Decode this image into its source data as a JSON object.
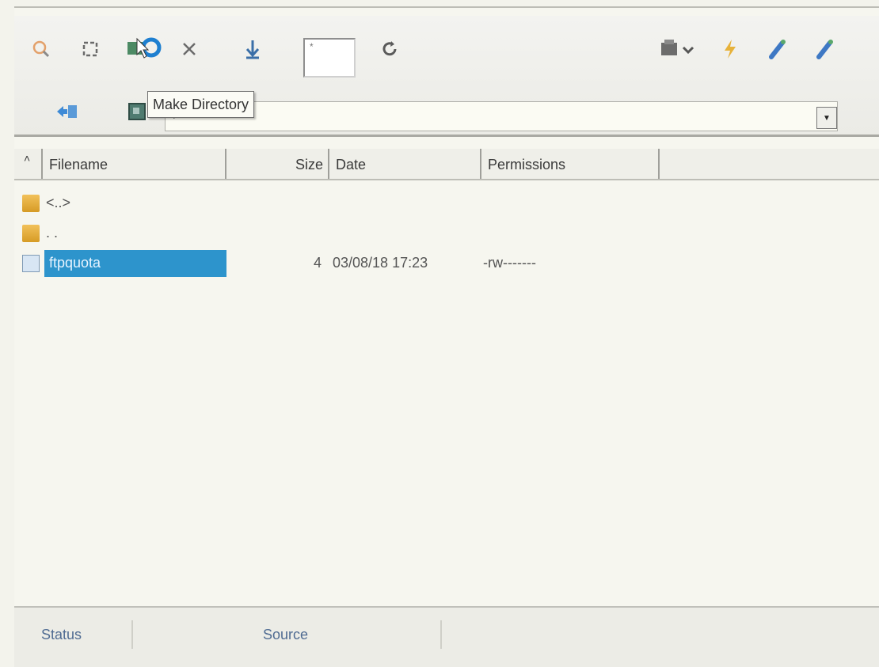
{
  "toolbar": {
    "filter_value": "*",
    "tooltip": "Make Directory",
    "icons": [
      "search-icon",
      "select-icon",
      "make-directory-icon",
      "delete-icon",
      "download-icon",
      "refresh-icon",
      "server-icon",
      "lightning-icon",
      "connect-icon",
      "disconnect-icon",
      "back-icon",
      "folder-icon"
    ]
  },
  "path": {
    "value": "/"
  },
  "columns": {
    "filename": "Filename",
    "size": "Size",
    "date": "Date",
    "permissions": "Permissions"
  },
  "files": [
    {
      "name": "<..>",
      "type": "folder",
      "size": "",
      "date": "",
      "permissions": ""
    },
    {
      "name": ". .",
      "type": "folder",
      "size": "",
      "date": "",
      "permissions": ""
    },
    {
      "name": "ftpquota",
      "type": "file",
      "size": "4",
      "date": "03/08/18 17:23",
      "permissions": "-rw-------",
      "selected": true
    }
  ],
  "statusbar": {
    "status": "Status",
    "source": "Source"
  }
}
